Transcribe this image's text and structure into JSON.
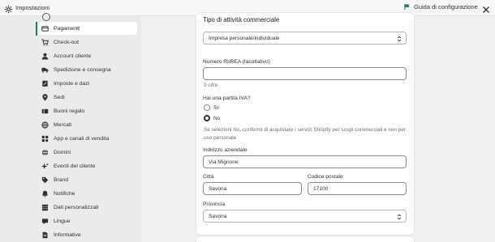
{
  "topbar": {
    "title": "Impostazioni",
    "guide_label": "Guida di configurazione"
  },
  "sidebar": {
    "items": [
      {
        "label": "Pagamenti",
        "icon": "payment-card-icon",
        "active": true
      },
      {
        "label": "Check-out",
        "icon": "cart-icon"
      },
      {
        "label": "Account cliente",
        "icon": "person-icon"
      },
      {
        "label": "Spedizione e consegna",
        "icon": "truck-icon"
      },
      {
        "label": "Imposte e dazi",
        "icon": "tax-icon"
      },
      {
        "label": "Sedi",
        "icon": "location-pin-icon"
      },
      {
        "label": "Buoni regalo",
        "icon": "gift-card-icon"
      },
      {
        "label": "Mercati",
        "icon": "globe-icon"
      },
      {
        "label": "App e canali di vendita",
        "icon": "apps-icon"
      },
      {
        "label": "Domini",
        "icon": "domain-globe-icon"
      },
      {
        "label": "Eventi del cliente",
        "icon": "sparkle-icon"
      },
      {
        "label": "Brand",
        "icon": "brand-tag-icon"
      },
      {
        "label": "Notifiche",
        "icon": "bell-icon"
      },
      {
        "label": "Dati personalizzati",
        "icon": "database-icon"
      },
      {
        "label": "Lingue",
        "icon": "language-icon"
      },
      {
        "label": "Informative",
        "icon": "document-icon"
      }
    ]
  },
  "form": {
    "business_type": {
      "label": "Tipo di attività commerciale",
      "value": "Impresa personale/individuale"
    },
    "rea": {
      "label": "Numero RI/REA (facoltativo)",
      "value": "",
      "helper": "9 cifre"
    },
    "vat": {
      "question": "Hai una partita IVA?",
      "options": [
        "Sì",
        "No"
      ],
      "selected": "No",
      "note": "Se selezioni No, confermi di acquistare i servizi Shopify per scopi commerciali e non per uso personale"
    },
    "address": {
      "label": "Indirizzo aziendale",
      "value": "Via Mignone"
    },
    "city": {
      "label": "Città",
      "value": "Savona"
    },
    "postal_code": {
      "label": "Codice postale",
      "value": "17100"
    },
    "province": {
      "label": "Provincia",
      "value": "Savona"
    }
  },
  "colors": {
    "active_indicator": "#1a7f5a",
    "page_background": "#f1f1f1",
    "sidebar_background": "#ebebeb"
  }
}
